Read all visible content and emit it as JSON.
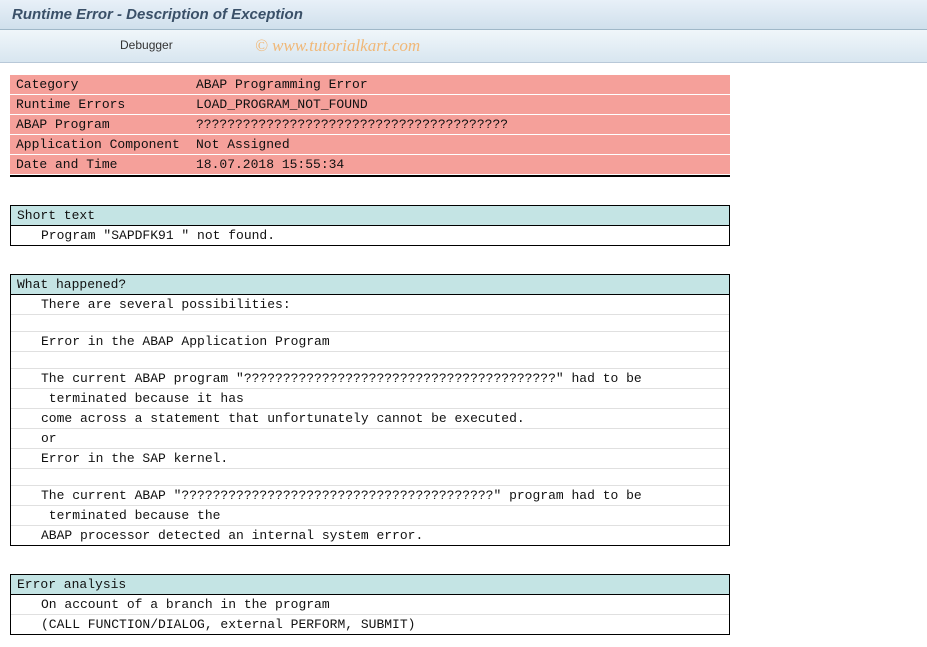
{
  "header": {
    "title": "Runtime Error - Description of Exception"
  },
  "toolbar": {
    "debugger_label": "Debugger"
  },
  "watermark": "© www.tutorialkart.com",
  "info": {
    "rows": [
      {
        "label": "Category",
        "value": "ABAP Programming Error"
      },
      {
        "label": "Runtime Errors",
        "value": "LOAD_PROGRAM_NOT_FOUND"
      },
      {
        "label": "ABAP Program",
        "value": "????????????????????????????????????????"
      },
      {
        "label": "Application Component",
        "value": "Not Assigned"
      },
      {
        "label": "Date and Time",
        "value": "18.07.2018 15:55:34"
      }
    ]
  },
  "sections": {
    "short_text": {
      "header": "Short text",
      "lines": [
        "Program \"SAPDFK91 \" not found."
      ]
    },
    "what_happened": {
      "header": "What happened?",
      "lines": [
        "There are several possibilities:",
        "",
        "Error in the ABAP Application Program",
        "",
        "The current ABAP program \"????????????????????????????????????????\" had to be",
        " terminated because it has",
        "come across a statement that unfortunately cannot be executed.",
        "or",
        "Error in the SAP kernel.",
        "",
        "The current ABAP \"????????????????????????????????????????\" program had to be",
        " terminated because the",
        "ABAP processor detected an internal system error."
      ]
    },
    "error_analysis": {
      "header": "Error analysis",
      "lines": [
        "On account of a branch in the program",
        "(CALL FUNCTION/DIALOG, external PERFORM, SUBMIT)"
      ]
    }
  }
}
